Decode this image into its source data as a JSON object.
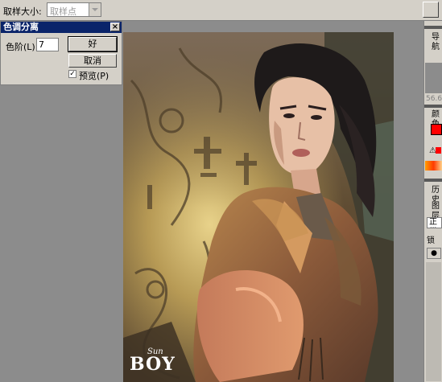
{
  "options_bar": {
    "sample_size_label": "取样大小:",
    "sample_size_value": "取样点"
  },
  "dialog": {
    "title": "色调分离",
    "close_glyph": "×",
    "levels_label": "色阶(L):",
    "levels_value": "7",
    "ok_label": "好",
    "cancel_label": "取消",
    "preview_checked": true,
    "preview_check_glyph": "✓",
    "preview_label": "预览(P)"
  },
  "right_panels": {
    "navigator_tab": "导航",
    "zoom_readout": "56.6",
    "color_tab": "颜色",
    "warning_glyph": "⚠",
    "history_tab": "历史",
    "layers_tab": "图层",
    "blend_mode_value": "正常",
    "lock_label": "锁定",
    "eye_glyph": "●"
  },
  "image": {
    "watermark_text": "BOY",
    "watermark_script": "Sun"
  },
  "colors": {
    "titlebar": "#0a246a",
    "chrome": "#d4d0c8",
    "workspace": "#8c8c8c",
    "foreground_swatch": "#ff0000"
  }
}
